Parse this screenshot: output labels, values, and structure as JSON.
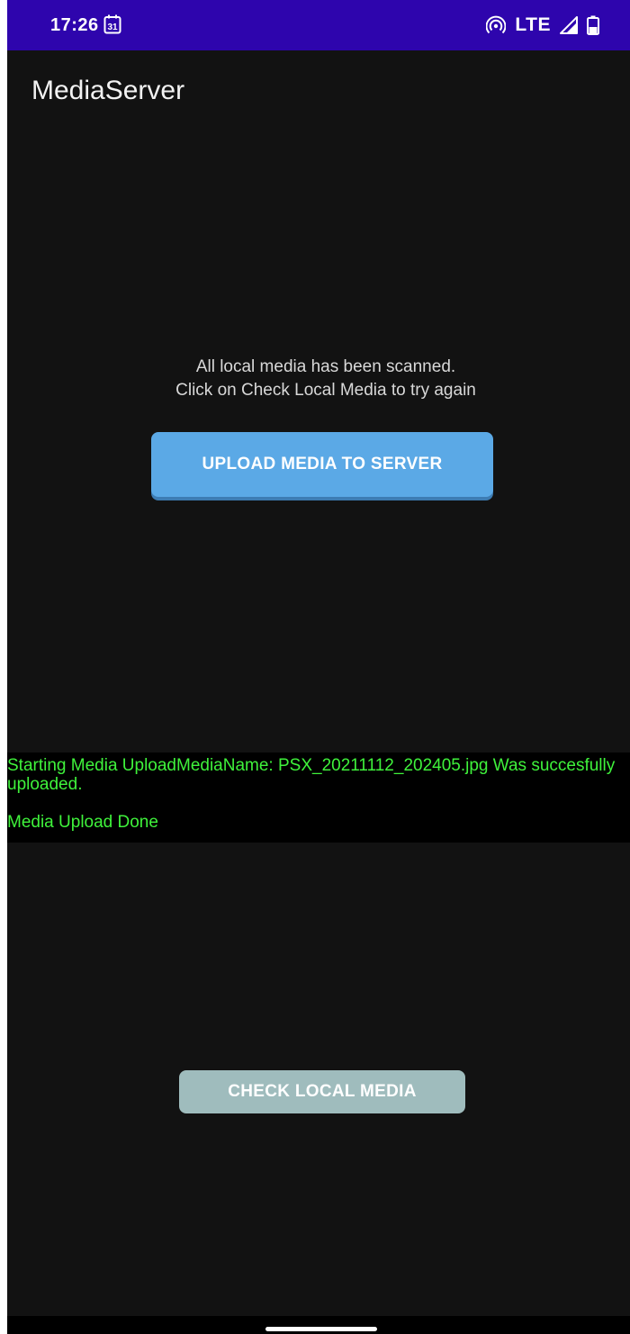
{
  "status_bar": {
    "time": "17:26",
    "calendar_day": "31",
    "network": "LTE",
    "icons": [
      "calendar-icon",
      "hotspot-icon",
      "signal-icon",
      "battery-icon"
    ],
    "background_color": "#2e05ad"
  },
  "app": {
    "title": "MediaServer"
  },
  "main": {
    "scan_message": "All local media has been scanned.\n Click on Check Local Media to try again",
    "upload_button_label": "UPLOAD MEDIA TO SERVER",
    "upload_button_color": "#5ba9e6"
  },
  "log": {
    "line1": "Starting Media UploadMediaName: PSX_20211112_202405.jpg Was succesfully uploaded.",
    "line2": "Media Upload Done",
    "text_color": "#3ff23b"
  },
  "footer": {
    "check_button_label": "CHECK LOCAL MEDIA",
    "check_button_color": "#9fbcbd"
  }
}
